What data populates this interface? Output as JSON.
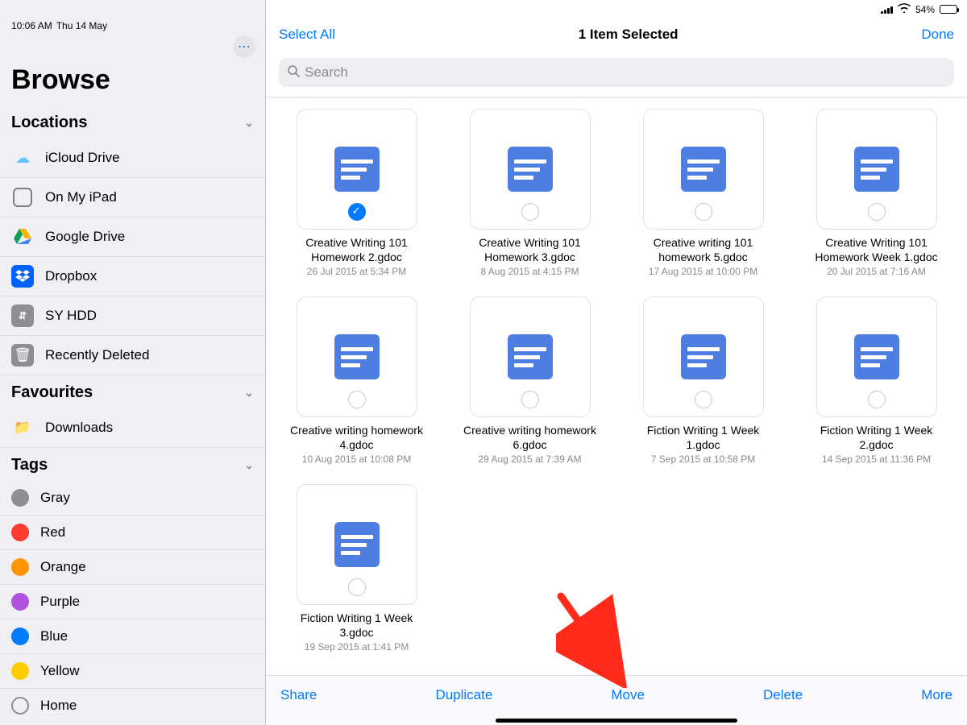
{
  "statusbar": {
    "time": "10:06 AM",
    "date": "Thu 14 May",
    "battery": "54%"
  },
  "sidebar": {
    "title": "Browse",
    "sections": {
      "locations_label": "Locations",
      "favourites_label": "Favourites",
      "tags_label": "Tags"
    },
    "locations": [
      {
        "label": "iCloud Drive"
      },
      {
        "label": "On My iPad"
      },
      {
        "label": "Google Drive"
      },
      {
        "label": "Dropbox"
      },
      {
        "label": "SY HDD"
      },
      {
        "label": "Recently Deleted"
      }
    ],
    "favourites": [
      {
        "label": "Downloads"
      }
    ],
    "tags": [
      {
        "label": "Gray",
        "color": "#8e8e93"
      },
      {
        "label": "Red",
        "color": "#ff3b30"
      },
      {
        "label": "Orange",
        "color": "#ff9500"
      },
      {
        "label": "Purple",
        "color": "#af52de"
      },
      {
        "label": "Blue",
        "color": "#007aff"
      },
      {
        "label": "Yellow",
        "color": "#ffcc00"
      },
      {
        "label": "Home",
        "color": ""
      }
    ]
  },
  "topbar": {
    "select_all": "Select All",
    "title": "1 Item Selected",
    "done": "Done"
  },
  "search": {
    "placeholder": "Search"
  },
  "files": [
    {
      "name": "Creative Writing 101 Homework 2.gdoc",
      "date": "26 Jul 2015 at 5:34 PM",
      "selected": true
    },
    {
      "name": "Creative Writing 101 Homework 3.gdoc",
      "date": "8 Aug 2015 at 4:15 PM",
      "selected": false
    },
    {
      "name": "Creative writing 101 homework 5.gdoc",
      "date": "17 Aug 2015 at 10:00 PM",
      "selected": false
    },
    {
      "name": "Creative Writing 101 Homework Week 1.gdoc",
      "date": "20 Jul 2015 at 7:16 AM",
      "selected": false
    },
    {
      "name": "Creative writing homework 4.gdoc",
      "date": "10 Aug 2015 at 10:08 PM",
      "selected": false
    },
    {
      "name": "Creative writing homework 6.gdoc",
      "date": "29 Aug 2015 at 7:39 AM",
      "selected": false
    },
    {
      "name": "Fiction Writing 1 Week 1.gdoc",
      "date": "7 Sep 2015 at 10:58 PM",
      "selected": false
    },
    {
      "name": "Fiction Writing 1 Week 2.gdoc",
      "date": "14 Sep 2015 at 11:36 PM",
      "selected": false
    },
    {
      "name": "Fiction Writing 1 Week 3.gdoc",
      "date": "19 Sep 2015 at 1:41 PM",
      "selected": false
    }
  ],
  "bottombar": {
    "share": "Share",
    "duplicate": "Duplicate",
    "move": "Move",
    "delete": "Delete",
    "more": "More"
  }
}
